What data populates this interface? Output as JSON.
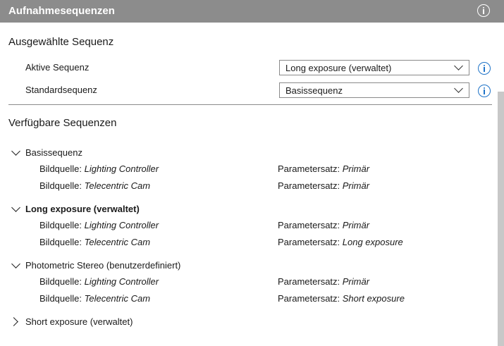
{
  "header": {
    "title": "Aufnahmesequenzen",
    "info_icon": "info-icon"
  },
  "selected": {
    "heading": "Ausgewählte Sequenz",
    "active_label": "Aktive Sequenz",
    "active_value": "Long exposure (verwaltet)",
    "default_label": "Standardsequenz",
    "default_value": "Basissequenz"
  },
  "available": {
    "heading": "Verfügbare Sequenzen",
    "source_label": "Bildquelle:",
    "param_label": "Parametersatz:",
    "sequences": [
      {
        "name": "Basissequenz",
        "expanded": true,
        "bold": false,
        "rows": [
          {
            "source": "Lighting Controller",
            "param": "Primär"
          },
          {
            "source": "Telecentric Cam",
            "param": "Primär"
          }
        ]
      },
      {
        "name": "Long exposure (verwaltet)",
        "expanded": true,
        "bold": true,
        "rows": [
          {
            "source": "Lighting Controller",
            "param": "Primär"
          },
          {
            "source": "Telecentric Cam",
            "param": "Long exposure"
          }
        ]
      },
      {
        "name": "Photometric Stereo (benutzerdefiniert)",
        "expanded": true,
        "bold": false,
        "rows": [
          {
            "source": "Lighting Controller",
            "param": "Primär"
          },
          {
            "source": "Telecentric Cam",
            "param": "Short exposure"
          }
        ]
      },
      {
        "name": "Short exposure (verwaltet)",
        "expanded": false,
        "bold": false,
        "rows": []
      }
    ]
  },
  "colors": {
    "header_bg": "#8c8c8c",
    "accent": "#1e73c8"
  }
}
